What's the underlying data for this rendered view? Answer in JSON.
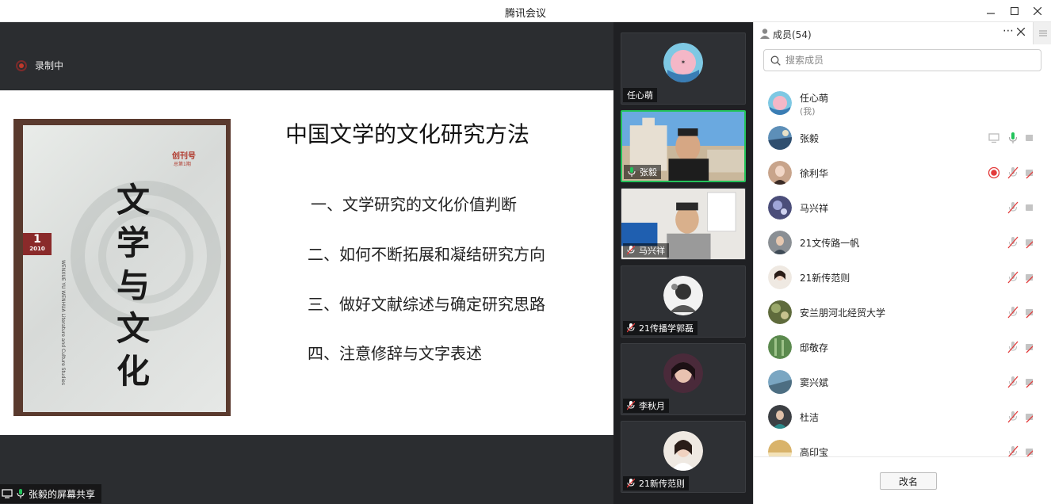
{
  "window": {
    "title": "腾讯会议"
  },
  "recording": {
    "label": "录制中"
  },
  "slide": {
    "title": "中国文学的文化研究方法",
    "items": [
      "一、文学研究的文化价值判断",
      "二、如何不断拓展和凝结研究方向",
      "三、做好文献综述与确定研究思路",
      "四、注意修辞与文字表述"
    ],
    "book": {
      "label_top": "创刊号",
      "label_sub": "总第1期",
      "issue": "1",
      "year": "2010",
      "calligraphy": "文学与文化",
      "spine_text": "WENXUE YU WENHUA Literature and Culture Studies"
    }
  },
  "share_label": "张毅的屏幕共享",
  "video_tiles": [
    {
      "name": "任心萌",
      "kind": "avatar",
      "mic": "none"
    },
    {
      "name": "张毅",
      "kind": "video",
      "mic": "on",
      "active": true
    },
    {
      "name": "马兴祥",
      "kind": "video",
      "mic": "muted"
    },
    {
      "name": "21传播学郭磊",
      "kind": "avatar",
      "mic": "muted"
    },
    {
      "name": "李秋月",
      "kind": "avatar",
      "mic": "muted"
    },
    {
      "name": "21新传范则",
      "kind": "avatar",
      "mic": "muted"
    }
  ],
  "members_panel": {
    "title": "成员(54)",
    "search_placeholder": "搜索成员",
    "rename_button": "改名",
    "members": [
      {
        "name": "任心萌",
        "sub": "(我)",
        "icons": []
      },
      {
        "name": "张毅",
        "sub": "",
        "icons": [
          "screen-share",
          "mic-on",
          "camera-off"
        ]
      },
      {
        "name": "徐利华",
        "sub": "",
        "icons": [
          "recording",
          "mic-muted",
          "camera-muted"
        ]
      },
      {
        "name": "马兴祥",
        "sub": "",
        "icons": [
          "mic-muted",
          "camera-off"
        ]
      },
      {
        "name": "21文传路一帆",
        "sub": "",
        "icons": [
          "mic-muted",
          "camera-muted"
        ]
      },
      {
        "name": "21新传范则",
        "sub": "",
        "icons": [
          "mic-muted",
          "camera-muted"
        ]
      },
      {
        "name": "安兰朋河北经贸大学",
        "sub": "",
        "icons": [
          "mic-muted",
          "camera-muted"
        ]
      },
      {
        "name": "邸敬存",
        "sub": "",
        "icons": [
          "mic-muted",
          "camera-muted"
        ]
      },
      {
        "name": "窦兴斌",
        "sub": "",
        "icons": [
          "mic-muted",
          "camera-muted"
        ]
      },
      {
        "name": "杜洁",
        "sub": "",
        "icons": [
          "mic-muted",
          "camera-muted"
        ]
      },
      {
        "name": "高印宝",
        "sub": "",
        "icons": [
          "mic-muted",
          "camera-muted"
        ]
      }
    ]
  },
  "colors": {
    "accent_green": "#23c35b",
    "record_red": "#e23b3b",
    "dark_bg": "#2b2d30"
  }
}
